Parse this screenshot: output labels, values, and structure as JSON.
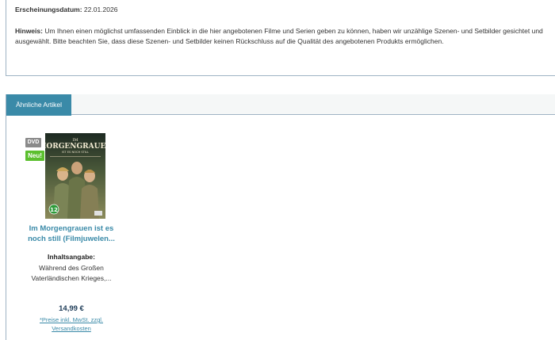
{
  "release": {
    "label": "Erscheinungsdatum:",
    "value": "22.01.2026"
  },
  "note": {
    "label": "Hinweis:",
    "text": "Um Ihnen einen möglichst umfassenden Einblick in die hier angebotenen Filme und Serien geben zu können, haben wir unzählige Szenen- und Setbilder gesichtet und ausgewählt. Bitte beachten Sie, dass diese Szenen- und Setbilder keinen Rückschluss auf die Qualität des angebotenen Produkts ermöglichen."
  },
  "similar": {
    "tab_label": "Ähnliche Artikel",
    "product": {
      "badge_format": "DVD",
      "badge_new": "Neu!",
      "cover_title_small": "IM",
      "cover_title": "MORGENGRAUEN",
      "cover_subtitle": "IST ES NOCH STILL",
      "cover_rating": "12",
      "title": "Im Morgengrauen ist es noch still (Filmjuwelen...",
      "content_label": "Inhaltsangabe:",
      "content_text": "Während des Großen Vaterländischen Krieges,...",
      "price": "14,99 €",
      "price_note": "*Preise inkl. MwSt. zzgl. Versandkosten"
    }
  },
  "colors": {
    "accent": "#3a8aa8",
    "new_badge": "#5bbf2e",
    "price": "#1d3b57",
    "border": "#9fb3c4"
  }
}
